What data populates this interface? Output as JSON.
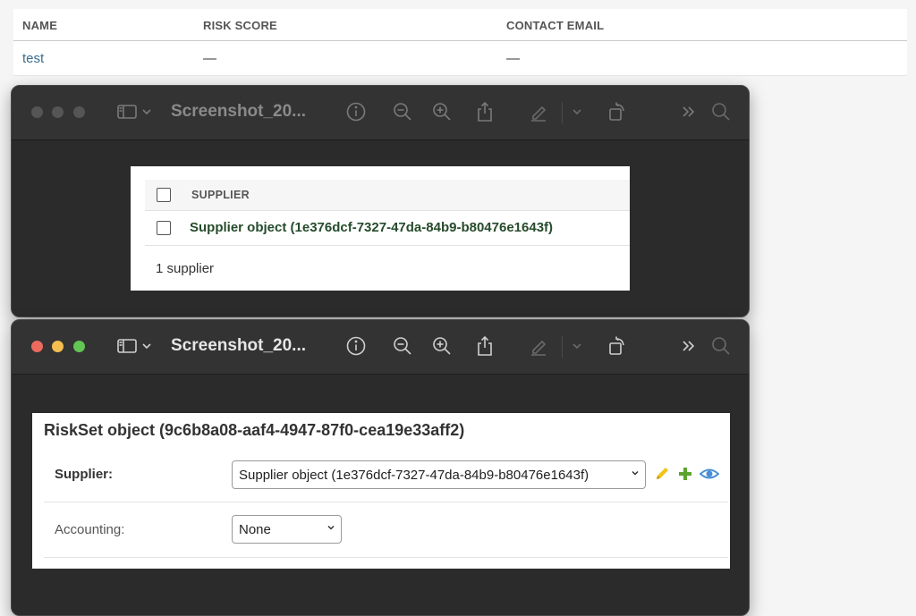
{
  "background_table": {
    "columns": [
      "NAME",
      "RISK SCORE",
      "CONTACT EMAIL"
    ],
    "rows": [
      {
        "name": "test",
        "risk_score": "—",
        "contact_email": "—"
      }
    ]
  },
  "window1": {
    "title": "Screenshot_20...",
    "table": {
      "header": "SUPPLIER",
      "rows": [
        "Supplier object (1e376dcf-7327-47da-84b9-b80476e1643f)"
      ],
      "count": "1 supplier"
    }
  },
  "window2": {
    "title": "Screenshot_20...",
    "form": {
      "title": "RiskSet object (9c6b8a08-aaf4-4947-87f0-cea19e33aff2)",
      "fields": [
        {
          "label": "Supplier:",
          "value": "Supplier object (1e376dcf-7327-47da-84b9-b80476e1643f)"
        },
        {
          "label": "Accounting:",
          "value": "None"
        }
      ]
    }
  },
  "colors": {
    "traffic_red": "#ed6a5e",
    "traffic_yellow": "#f5bf4f",
    "traffic_green": "#62c554",
    "link_blue": "#3a6d8c",
    "supplier_green": "#264b2b",
    "edit_icon": "#f0c419",
    "add_icon": "#5aa52e",
    "view_icon": "#4a8fd6"
  },
  "icons": [
    "sidebar-icon",
    "chevron-down-icon",
    "info-icon",
    "zoom-out-icon",
    "zoom-in-icon",
    "share-icon",
    "markup-icon",
    "rotate-icon",
    "more-icon",
    "search-icon",
    "pencil-icon",
    "plus-icon",
    "eye-icon"
  ]
}
